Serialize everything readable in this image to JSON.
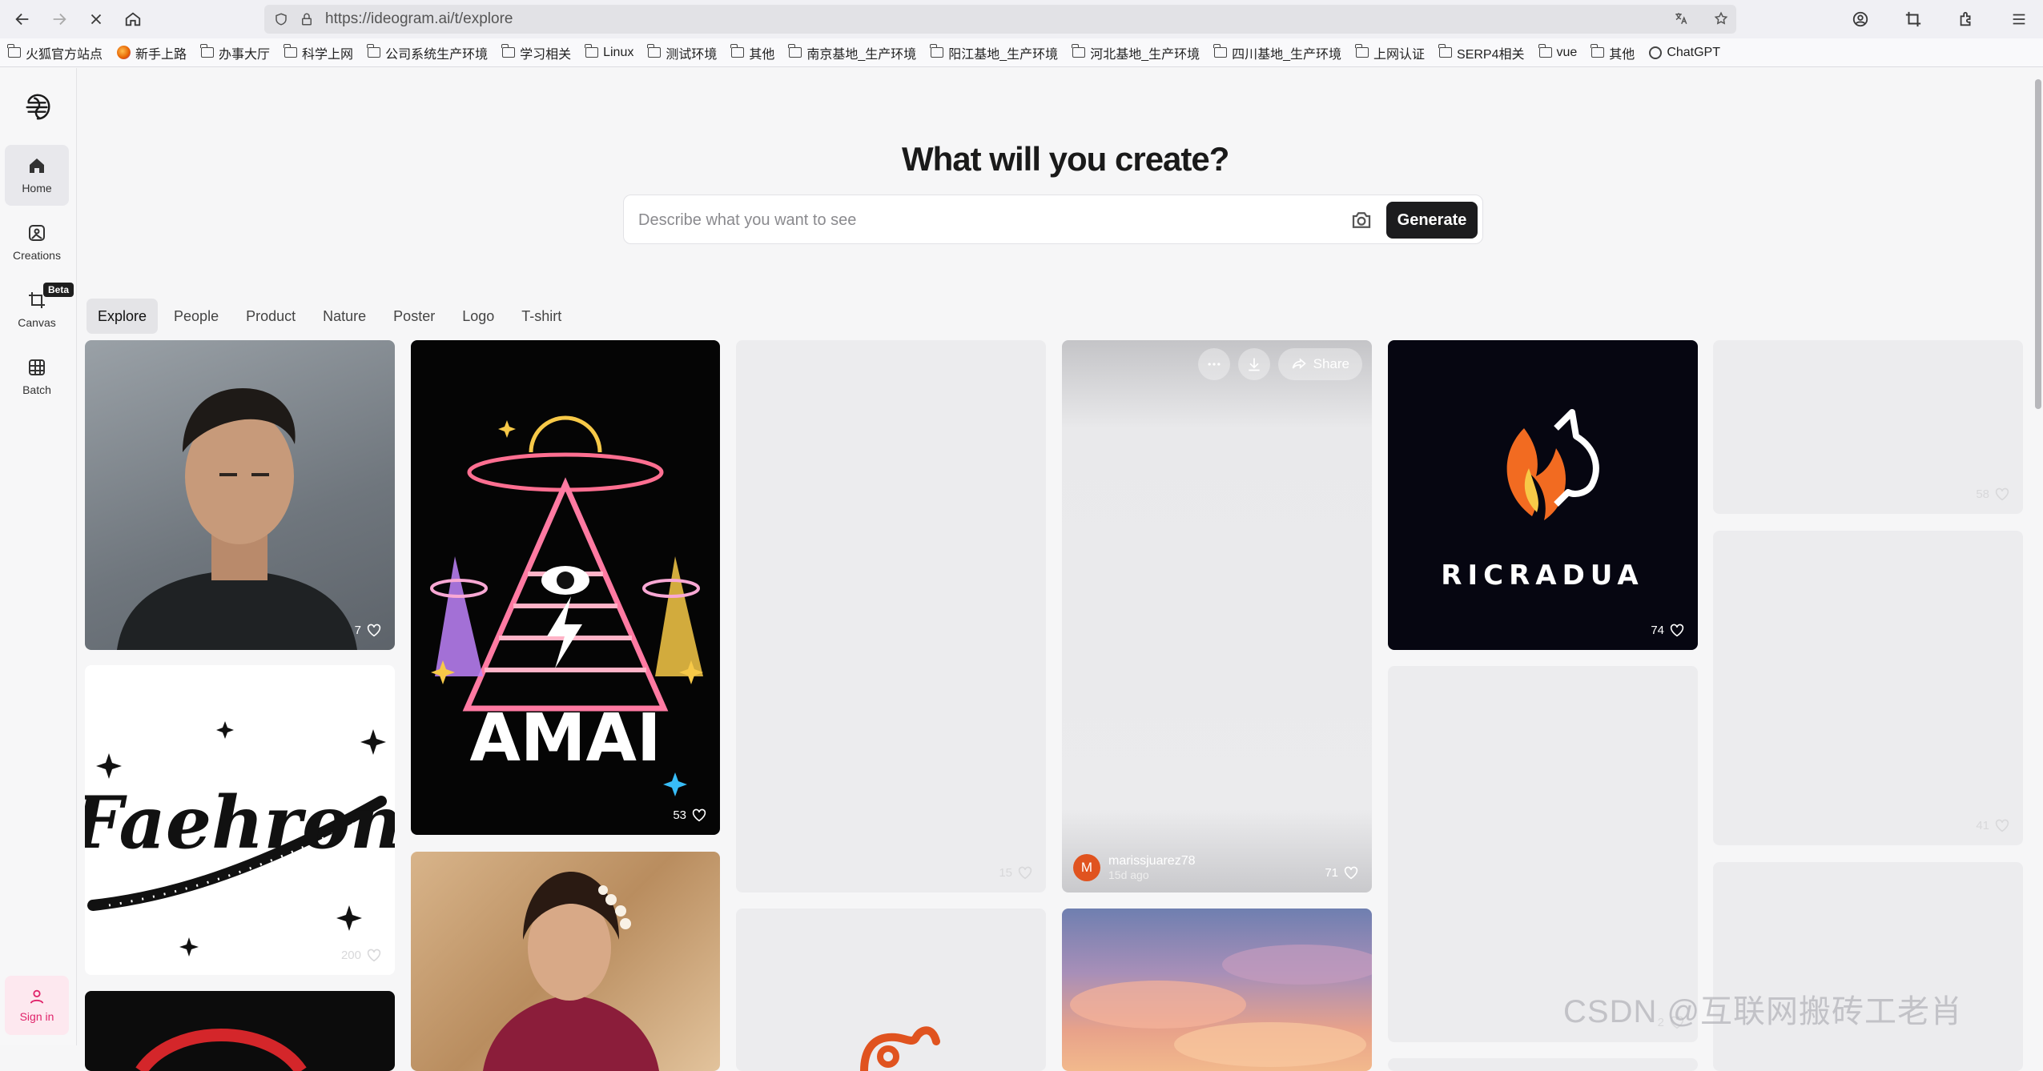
{
  "browser": {
    "url": "https://ideogram.ai/t/explore",
    "bookmarks": [
      "火狐官方站点",
      "新手上路",
      "办事大厅",
      "科学上网",
      "公司系统生产环境",
      "学习相关",
      "Linux",
      "测试环境",
      "其他",
      "南京基地_生产环境",
      "阳江基地_生产环境",
      "河北基地_生产环境",
      "四川基地_生产环境",
      "上网认证",
      "SERP4相关",
      "vue",
      "其他",
      "ChatGPT"
    ]
  },
  "sidebar": {
    "items": [
      {
        "label": "Home"
      },
      {
        "label": "Creations"
      },
      {
        "label": "Canvas",
        "badge": "Beta"
      },
      {
        "label": "Batch"
      }
    ],
    "signin": "Sign in"
  },
  "hero": {
    "title": "What will you create?",
    "placeholder": "Describe what you want to see",
    "generate": "Generate"
  },
  "tabs": [
    "Explore",
    "People",
    "Product",
    "Nature",
    "Poster",
    "Logo",
    "T-shirt"
  ],
  "cards": {
    "portrait_likes": "7",
    "amai_text": "AMAI",
    "amai_likes": "53",
    "blank1_likes": "15",
    "featured_likes": "71",
    "featured_author": "marissjuarez78",
    "featured_avatar": "M",
    "featured_time": "15d ago",
    "share": "Share",
    "ricradua_text": "RICRADUA",
    "ricradua_likes": "74",
    "col6a_likes": "58",
    "faehron_text": "Faehron",
    "faehron_likes": "200",
    "col5b_likes": "2",
    "col6b_likes": "41"
  },
  "colors": {
    "accent": "#1c1c1e",
    "signin": "#e0236a",
    "avatar": "#e0531f"
  },
  "watermark": "CSDN @互联网搬砖工老肖"
}
